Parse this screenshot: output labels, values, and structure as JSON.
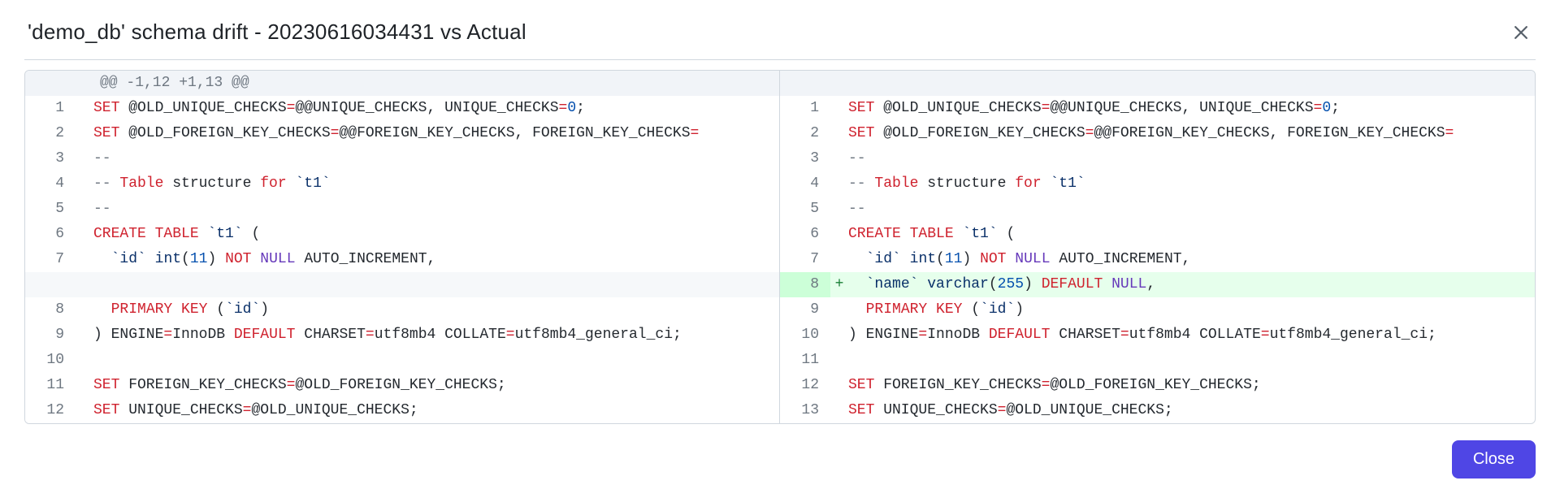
{
  "dialog": {
    "title": "'demo_db' schema drift - 20230616034431 vs Actual",
    "close_label": "Close"
  },
  "diff": {
    "hunk_header": "@@ -1,12 +1,13 @@",
    "sides": {
      "left": [
        {
          "n": 1,
          "kind": "ctx",
          "tokens": [
            [
              "kw",
              "SET"
            ],
            [
              "",
              " @OLD_UNIQUE_CHECKS"
            ],
            [
              "kw",
              "="
            ],
            [
              "",
              "@@UNIQUE_CHECKS, UNIQUE_CHECKS"
            ],
            [
              "kw",
              "="
            ],
            [
              "num",
              "0"
            ],
            [
              "",
              ";"
            ]
          ]
        },
        {
          "n": 2,
          "kind": "ctx",
          "tokens": [
            [
              "kw",
              "SET"
            ],
            [
              "",
              " @OLD_FOREIGN_KEY_CHECKS"
            ],
            [
              "kw",
              "="
            ],
            [
              "",
              "@@FOREIGN_KEY_CHECKS, FOREIGN_KEY_CHECKS"
            ],
            [
              "kw",
              "="
            ]
          ]
        },
        {
          "n": 3,
          "kind": "ctx",
          "tokens": [
            [
              "cmt",
              "--"
            ]
          ]
        },
        {
          "n": 4,
          "kind": "ctx",
          "tokens": [
            [
              "cmt",
              "-- "
            ],
            [
              "kw",
              "Table"
            ],
            [
              "",
              " structure "
            ],
            [
              "kw",
              "for"
            ],
            [
              "",
              " "
            ],
            [
              "str",
              "`t1`"
            ]
          ]
        },
        {
          "n": 5,
          "kind": "ctx",
          "tokens": [
            [
              "cmt",
              "--"
            ]
          ]
        },
        {
          "n": 6,
          "kind": "ctx",
          "tokens": [
            [
              "kw",
              "CREATE"
            ],
            [
              "",
              " "
            ],
            [
              "kw",
              "TABLE"
            ],
            [
              "",
              " "
            ],
            [
              "str",
              "`t1`"
            ],
            [
              "",
              " ("
            ]
          ]
        },
        {
          "n": 7,
          "kind": "ctx",
          "tokens": [
            [
              "",
              "  "
            ],
            [
              "str",
              "`id`"
            ],
            [
              "",
              " "
            ],
            [
              "type",
              "int"
            ],
            [
              "",
              "("
            ],
            [
              "num",
              "11"
            ],
            [
              "",
              ") "
            ],
            [
              "kw",
              "NOT"
            ],
            [
              "",
              " "
            ],
            [
              "lit",
              "NULL"
            ],
            [
              "",
              " AUTO_INCREMENT,"
            ]
          ]
        },
        {
          "n": null,
          "kind": "empty",
          "tokens": []
        },
        {
          "n": 8,
          "kind": "ctx",
          "tokens": [
            [
              "",
              "  "
            ],
            [
              "kw",
              "PRIMARY"
            ],
            [
              "",
              " "
            ],
            [
              "kw",
              "KEY"
            ],
            [
              "",
              " ("
            ],
            [
              "str",
              "`id`"
            ],
            [
              "",
              ")"
            ]
          ]
        },
        {
          "n": 9,
          "kind": "ctx",
          "tokens": [
            [
              "",
              ") ENGINE"
            ],
            [
              "kw",
              "="
            ],
            [
              "",
              "InnoDB "
            ],
            [
              "kw",
              "DEFAULT"
            ],
            [
              "",
              " CHARSET"
            ],
            [
              "kw",
              "="
            ],
            [
              "",
              "utf8mb4 COLLATE"
            ],
            [
              "kw",
              "="
            ],
            [
              "",
              "utf8mb4_general_ci;"
            ]
          ]
        },
        {
          "n": 10,
          "kind": "ctx",
          "tokens": []
        },
        {
          "n": 11,
          "kind": "ctx",
          "tokens": [
            [
              "kw",
              "SET"
            ],
            [
              "",
              " FOREIGN_KEY_CHECKS"
            ],
            [
              "kw",
              "="
            ],
            [
              "",
              "@OLD_FOREIGN_KEY_CHECKS;"
            ]
          ]
        },
        {
          "n": 12,
          "kind": "ctx",
          "tokens": [
            [
              "kw",
              "SET"
            ],
            [
              "",
              " UNIQUE_CHECKS"
            ],
            [
              "kw",
              "="
            ],
            [
              "",
              "@OLD_UNIQUE_CHECKS;"
            ]
          ]
        }
      ],
      "right": [
        {
          "n": 1,
          "kind": "ctx",
          "tokens": [
            [
              "kw",
              "SET"
            ],
            [
              "",
              " @OLD_UNIQUE_CHECKS"
            ],
            [
              "kw",
              "="
            ],
            [
              "",
              "@@UNIQUE_CHECKS, UNIQUE_CHECKS"
            ],
            [
              "kw",
              "="
            ],
            [
              "num",
              "0"
            ],
            [
              "",
              ";"
            ]
          ]
        },
        {
          "n": 2,
          "kind": "ctx",
          "tokens": [
            [
              "kw",
              "SET"
            ],
            [
              "",
              " @OLD_FOREIGN_KEY_CHECKS"
            ],
            [
              "kw",
              "="
            ],
            [
              "",
              "@@FOREIGN_KEY_CHECKS, FOREIGN_KEY_CHECKS"
            ],
            [
              "kw",
              "="
            ]
          ]
        },
        {
          "n": 3,
          "kind": "ctx",
          "tokens": [
            [
              "cmt",
              "--"
            ]
          ]
        },
        {
          "n": 4,
          "kind": "ctx",
          "tokens": [
            [
              "cmt",
              "-- "
            ],
            [
              "kw",
              "Table"
            ],
            [
              "",
              " structure "
            ],
            [
              "kw",
              "for"
            ],
            [
              "",
              " "
            ],
            [
              "str",
              "`t1`"
            ]
          ]
        },
        {
          "n": 5,
          "kind": "ctx",
          "tokens": [
            [
              "cmt",
              "--"
            ]
          ]
        },
        {
          "n": 6,
          "kind": "ctx",
          "tokens": [
            [
              "kw",
              "CREATE"
            ],
            [
              "",
              " "
            ],
            [
              "kw",
              "TABLE"
            ],
            [
              "",
              " "
            ],
            [
              "str",
              "`t1`"
            ],
            [
              "",
              " ("
            ]
          ]
        },
        {
          "n": 7,
          "kind": "ctx",
          "tokens": [
            [
              "",
              "  "
            ],
            [
              "str",
              "`id`"
            ],
            [
              "",
              " "
            ],
            [
              "type",
              "int"
            ],
            [
              "",
              "("
            ],
            [
              "num",
              "11"
            ],
            [
              "",
              ") "
            ],
            [
              "kw",
              "NOT"
            ],
            [
              "",
              " "
            ],
            [
              "lit",
              "NULL"
            ],
            [
              "",
              " AUTO_INCREMENT,"
            ]
          ]
        },
        {
          "n": 8,
          "kind": "add",
          "tokens": [
            [
              "",
              "  "
            ],
            [
              "str",
              "`name`"
            ],
            [
              "",
              " "
            ],
            [
              "type",
              "varchar"
            ],
            [
              "",
              "("
            ],
            [
              "num",
              "255"
            ],
            [
              "",
              ") "
            ],
            [
              "kw",
              "DEFAULT"
            ],
            [
              "",
              " "
            ],
            [
              "lit",
              "NULL"
            ],
            [
              "",
              ","
            ]
          ]
        },
        {
          "n": 9,
          "kind": "ctx",
          "tokens": [
            [
              "",
              "  "
            ],
            [
              "kw",
              "PRIMARY"
            ],
            [
              "",
              " "
            ],
            [
              "kw",
              "KEY"
            ],
            [
              "",
              " ("
            ],
            [
              "str",
              "`id`"
            ],
            [
              "",
              ")"
            ]
          ]
        },
        {
          "n": 10,
          "kind": "ctx",
          "tokens": [
            [
              "",
              ") ENGINE"
            ],
            [
              "kw",
              "="
            ],
            [
              "",
              "InnoDB "
            ],
            [
              "kw",
              "DEFAULT"
            ],
            [
              "",
              " CHARSET"
            ],
            [
              "kw",
              "="
            ],
            [
              "",
              "utf8mb4 COLLATE"
            ],
            [
              "kw",
              "="
            ],
            [
              "",
              "utf8mb4_general_ci;"
            ]
          ]
        },
        {
          "n": 11,
          "kind": "ctx",
          "tokens": []
        },
        {
          "n": 12,
          "kind": "ctx",
          "tokens": [
            [
              "kw",
              "SET"
            ],
            [
              "",
              " FOREIGN_KEY_CHECKS"
            ],
            [
              "kw",
              "="
            ],
            [
              "",
              "@OLD_FOREIGN_KEY_CHECKS;"
            ]
          ]
        },
        {
          "n": 13,
          "kind": "ctx",
          "tokens": [
            [
              "kw",
              "SET"
            ],
            [
              "",
              " UNIQUE_CHECKS"
            ],
            [
              "kw",
              "="
            ],
            [
              "",
              "@OLD_UNIQUE_CHECKS;"
            ]
          ]
        }
      ]
    }
  }
}
